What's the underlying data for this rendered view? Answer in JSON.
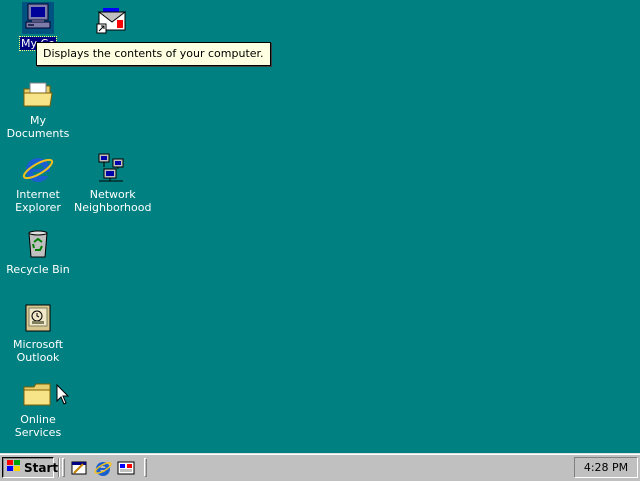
{
  "desktop": {
    "icons": [
      {
        "id": "my-computer",
        "label": "My Computer",
        "visible_label": "My Co"
      },
      {
        "id": "inbox",
        "label": ""
      },
      {
        "id": "my-documents",
        "label": "My Documents"
      },
      {
        "id": "internet-explorer",
        "label": "Internet Explorer"
      },
      {
        "id": "network-neighborhood",
        "label": "Network Neighborhood"
      },
      {
        "id": "recycle-bin",
        "label": "Recycle Bin"
      },
      {
        "id": "microsoft-outlook",
        "label": "Microsoft Outlook"
      },
      {
        "id": "online-services",
        "label": "Online Services"
      }
    ],
    "tooltip": "Displays the contents of your computer.",
    "background_color": "#008080",
    "selection_color": "#000080"
  },
  "taskbar": {
    "start_label": "Start",
    "clock": "4:28 PM",
    "quick_launch": [
      "show-desktop-icon",
      "internet-explorer-icon",
      "channels-icon"
    ]
  }
}
